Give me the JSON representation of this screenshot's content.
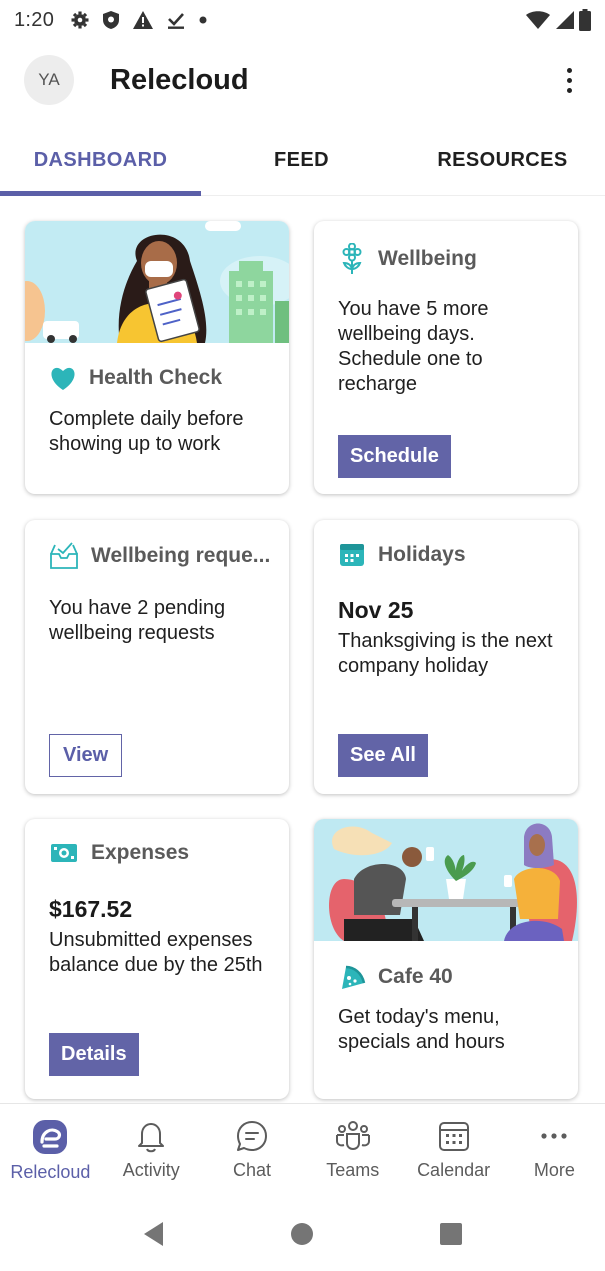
{
  "status_bar": {
    "time": "1:20"
  },
  "header": {
    "avatar_initials": "YA",
    "app_title": "Relecloud"
  },
  "tabs": [
    {
      "label": "DASHBOARD",
      "active": true
    },
    {
      "label": "FEED",
      "active": false
    },
    {
      "label": "RESOURCES",
      "active": false
    }
  ],
  "cards": {
    "health_check": {
      "title": "Health Check",
      "body": "Complete daily before showing up to work"
    },
    "wellbeing": {
      "title": "Wellbeing",
      "body": "You have 5 more wellbeing days. Schedule one to recharge",
      "button": "Schedule"
    },
    "wellbeing_requests": {
      "title": "Wellbeing reque...",
      "body": "You have 2 pending wellbeing requests",
      "button": "View"
    },
    "holidays": {
      "title": "Holidays",
      "date": "Nov 25",
      "body": "Thanksgiving is the next company holiday",
      "button": "See All"
    },
    "expenses": {
      "title": "Expenses",
      "amount": "$167.52",
      "body": "Unsubmitted expenses balance due by the 25th",
      "button": "Details"
    },
    "cafe": {
      "title": "Cafe 40",
      "body": "Get today's menu, specials and hours"
    }
  },
  "bottom_nav": [
    {
      "label": "Relecloud",
      "icon": "relecloud-logo-icon",
      "active": true
    },
    {
      "label": "Activity",
      "icon": "bell-icon",
      "active": false
    },
    {
      "label": "Chat",
      "icon": "chat-icon",
      "active": false
    },
    {
      "label": "Teams",
      "icon": "teams-icon",
      "active": false
    },
    {
      "label": "Calendar",
      "icon": "calendar-icon",
      "active": false
    },
    {
      "label": "More",
      "icon": "more-icon",
      "active": false
    }
  ],
  "colors": {
    "accent": "#6264a7",
    "teal": "#2cb5b9",
    "banner_sky": "#bfe9f2"
  }
}
